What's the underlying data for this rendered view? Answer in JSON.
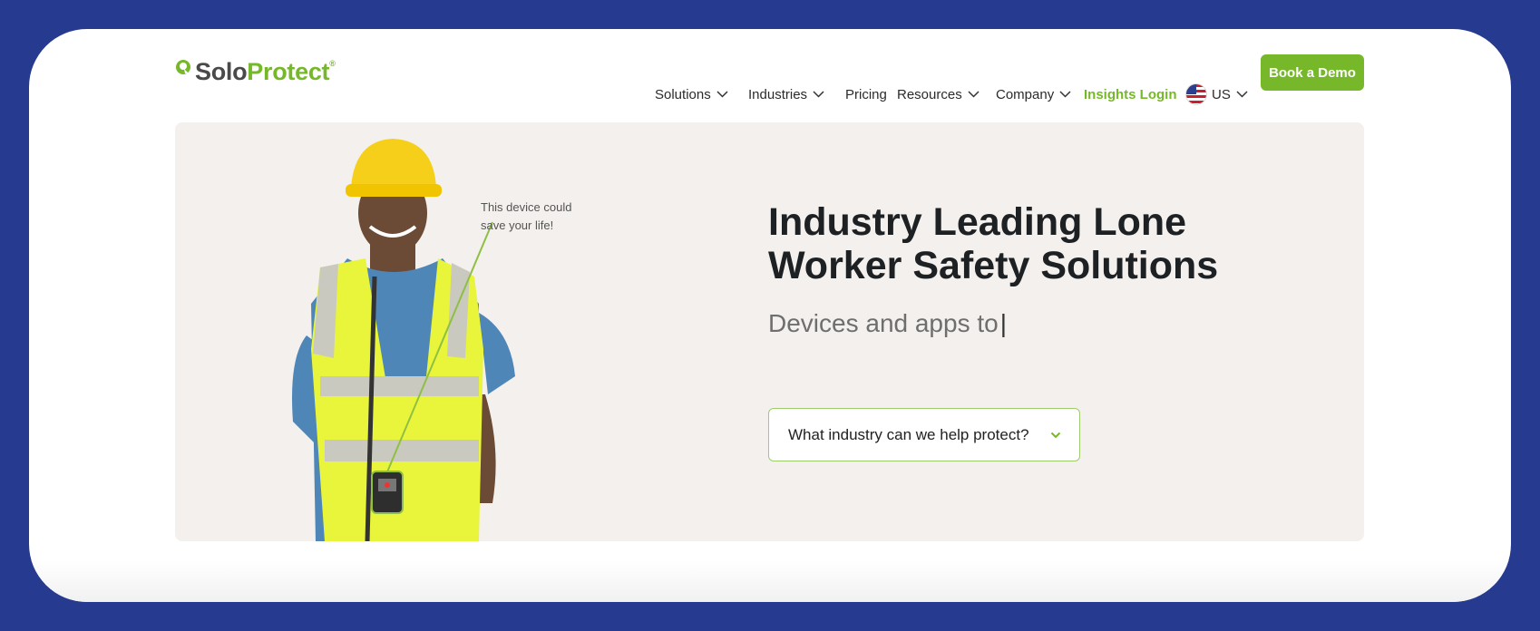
{
  "brand": {
    "name_part1": "Solo",
    "name_part2": "Protect",
    "registered": "®",
    "accent": "#76b82a"
  },
  "nav": {
    "solutions": "Solutions",
    "industries": "Industries",
    "pricing": "Pricing",
    "resources": "Resources",
    "company": "Company",
    "insights_login": "Insights Login",
    "region": "US"
  },
  "cta": {
    "book_demo": "Book a Demo"
  },
  "hero": {
    "callout": "This device could save your life!",
    "headline": "Industry Leading Lone Worker Safety Solutions",
    "subline": "Devices and apps to",
    "cursor": "|",
    "select_placeholder": "What industry can we help protect?"
  },
  "colors": {
    "page_bg": "#263a8f",
    "hero_bg": "#f3f0ed",
    "accent": "#76b82a"
  },
  "icons": [
    "logo-mark-icon",
    "chevron-down-icon",
    "us-flag-icon",
    "worker-illustration"
  ]
}
